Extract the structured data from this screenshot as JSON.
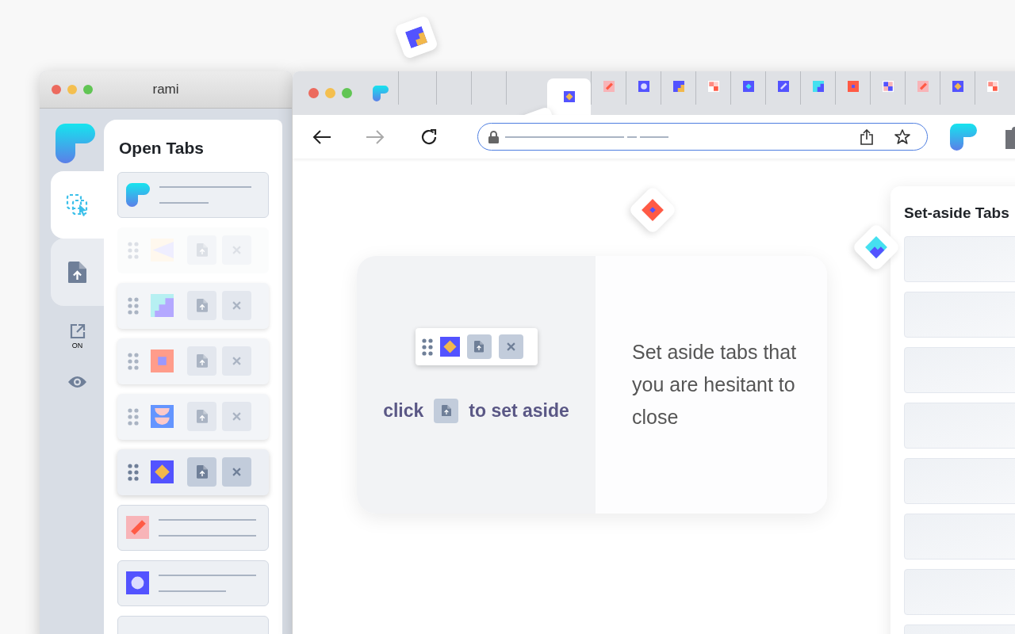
{
  "side_window": {
    "title": "rami"
  },
  "sidebar": {
    "tabs": [
      {
        "selected": true
      },
      {
        "selected": false
      }
    ],
    "toggle_label": "ON"
  },
  "open_tabs": {
    "title": "Open Tabs",
    "rows": [
      {
        "kind": "collapsed"
      },
      {
        "kind": "expanded",
        "faded": true,
        "hovered": false
      },
      {
        "kind": "expanded",
        "faded": false,
        "hovered": false
      },
      {
        "kind": "expanded",
        "faded": false,
        "hovered": false
      },
      {
        "kind": "expanded",
        "faded": false,
        "hovered": false
      },
      {
        "kind": "expanded",
        "faded": false,
        "hovered": true
      },
      {
        "kind": "collapsed"
      },
      {
        "kind": "collapsed"
      },
      {
        "kind": "collapsed"
      }
    ]
  },
  "browser": {
    "tabs": [
      {
        "kind": "blank",
        "selected": false
      },
      {
        "kind": "blank",
        "selected": false
      },
      {
        "kind": "blank",
        "selected": false
      },
      {
        "kind": "blank",
        "selected": false
      },
      {
        "kind": "favicon",
        "selected": true
      },
      {
        "kind": "favicon",
        "selected": false
      },
      {
        "kind": "favicon",
        "selected": false
      },
      {
        "kind": "favicon",
        "selected": false
      },
      {
        "kind": "favicon",
        "selected": false
      },
      {
        "kind": "favicon",
        "selected": false
      },
      {
        "kind": "favicon",
        "selected": false
      },
      {
        "kind": "favicon",
        "selected": false
      },
      {
        "kind": "favicon",
        "selected": false
      },
      {
        "kind": "favicon",
        "selected": false
      },
      {
        "kind": "favicon",
        "selected": false
      },
      {
        "kind": "favicon",
        "selected": false
      },
      {
        "kind": "favicon",
        "selected": false
      }
    ]
  },
  "feature_card": {
    "hint_before": "click",
    "hint_after": "to set aside",
    "description": "Set aside tabs that you are hesitant to close"
  },
  "set_aside": {
    "title": "Set-aside Tabs"
  }
}
